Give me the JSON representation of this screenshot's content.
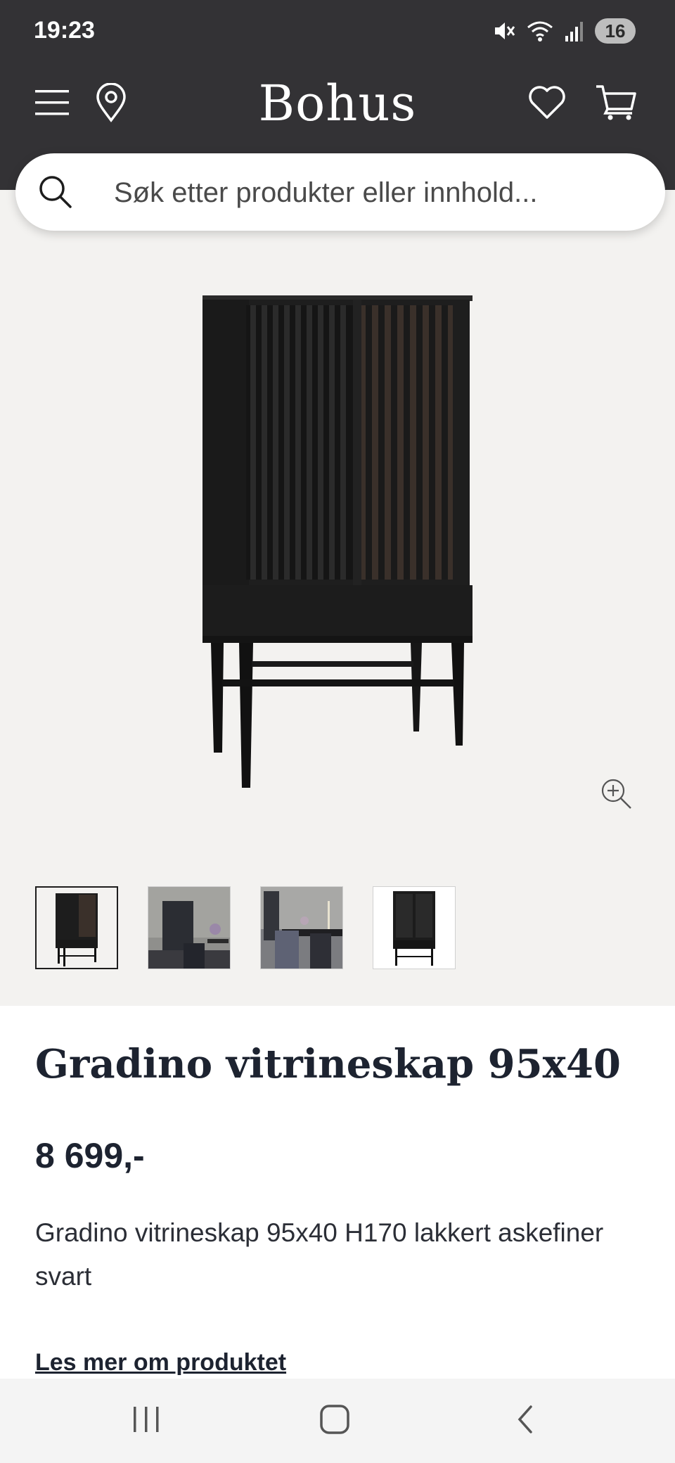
{
  "status_bar": {
    "time": "19:23",
    "battery": "16",
    "icons": [
      "mute-icon",
      "wifi-icon",
      "signal-icon"
    ]
  },
  "header": {
    "logo": "Bohus",
    "icons": [
      "menu-icon",
      "location-pin-icon",
      "heart-icon",
      "cart-icon"
    ]
  },
  "search": {
    "placeholder": "Søk etter produkter eller innhold..."
  },
  "gallery": {
    "thumbnail_count": 4,
    "active_thumbnail": 1
  },
  "product": {
    "title": "Gradino vitrineskap 95x40",
    "price": "8 699,-",
    "description": "Gradino vitrineskap 95x40 H170 lakkert askefiner svart",
    "more_link": "Les mer om produktet"
  },
  "nav_bar": {
    "icons": [
      "recent-apps-icon",
      "home-icon",
      "back-icon"
    ]
  },
  "colors": {
    "header_bg": "#333235",
    "gallery_bg": "#f3f2f0",
    "text_dark": "#1d2330"
  }
}
